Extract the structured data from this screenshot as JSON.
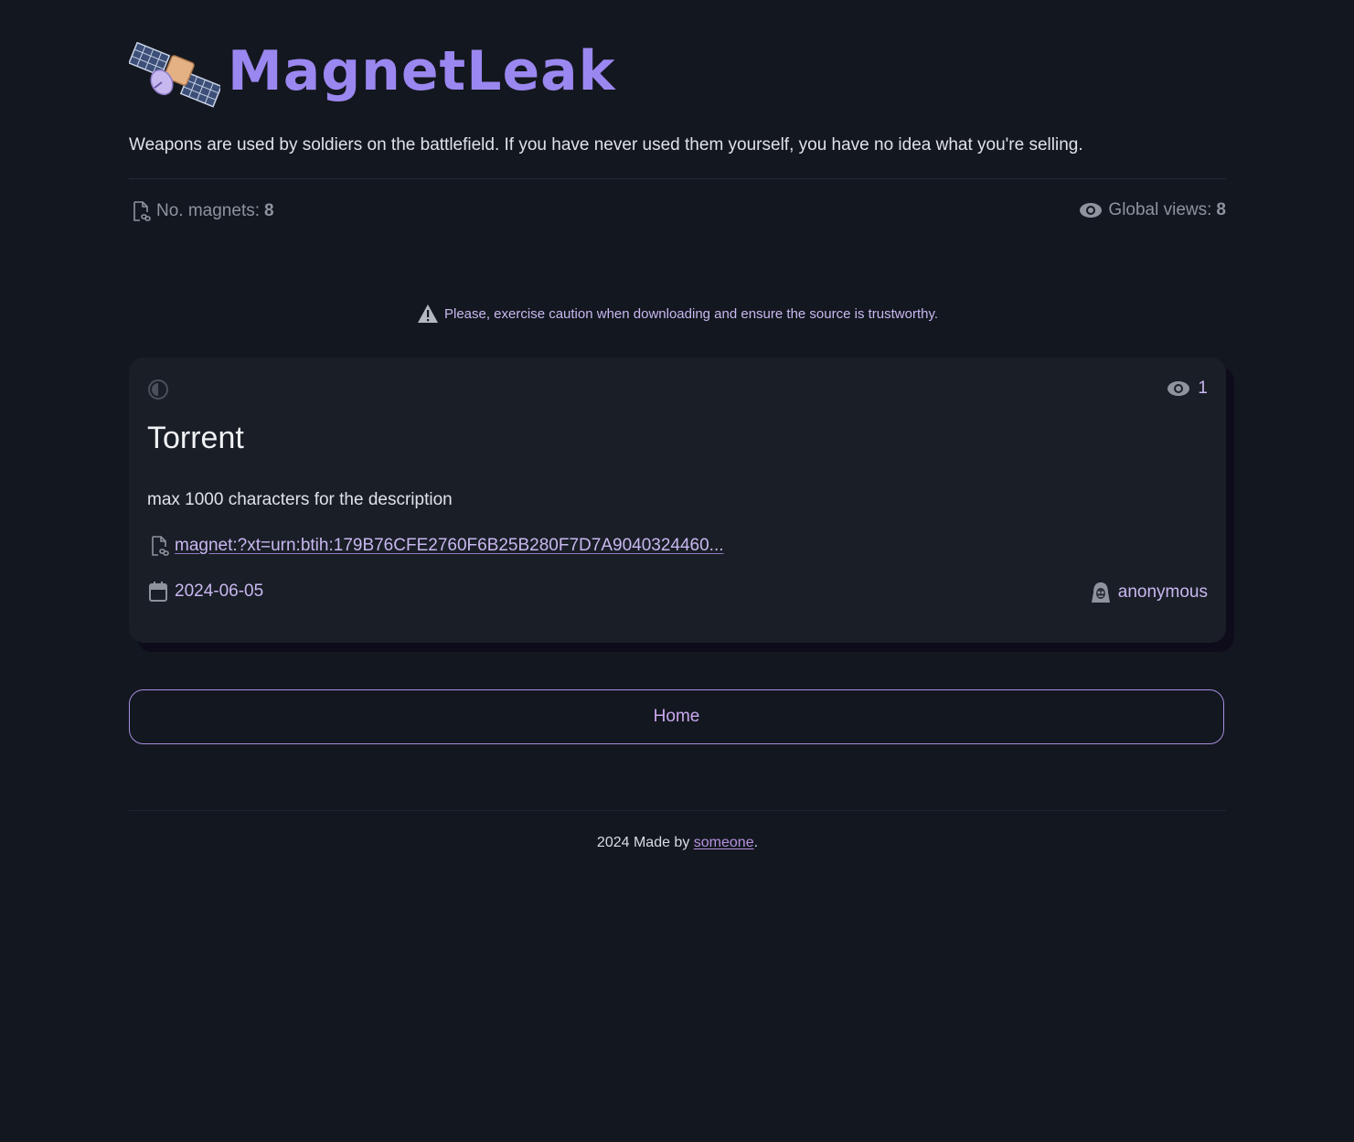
{
  "header": {
    "site_name": "MagnetLeak",
    "tagline": "Weapons are used by soldiers on the battlefield. If you have never used them yourself, you have no idea what you're selling."
  },
  "stats": {
    "magnets_label": "No. magnets:",
    "magnets_count": "8",
    "views_label": "Global views:",
    "views_count": "8"
  },
  "warning": {
    "text": "Please, exercise caution when downloading and ensure the source is trustworthy."
  },
  "torrent": {
    "views": "1",
    "title": "Torrent",
    "description": "max 1000 characters for the description",
    "magnet": "magnet:?xt=urn:btih:179B76CFE2760F6B25B280F7D7A9040324460...",
    "date": "2024-06-05",
    "author": "anonymous"
  },
  "nav": {
    "home_label": "Home"
  },
  "footer": {
    "prefix": "2024 Made by ",
    "link_text": "someone",
    "suffix": "."
  },
  "colors": {
    "background": "#13171f",
    "card": "#1a1e27",
    "accent": "#9b87f0",
    "link": "#c8b8f0",
    "muted": "#8d949e"
  }
}
